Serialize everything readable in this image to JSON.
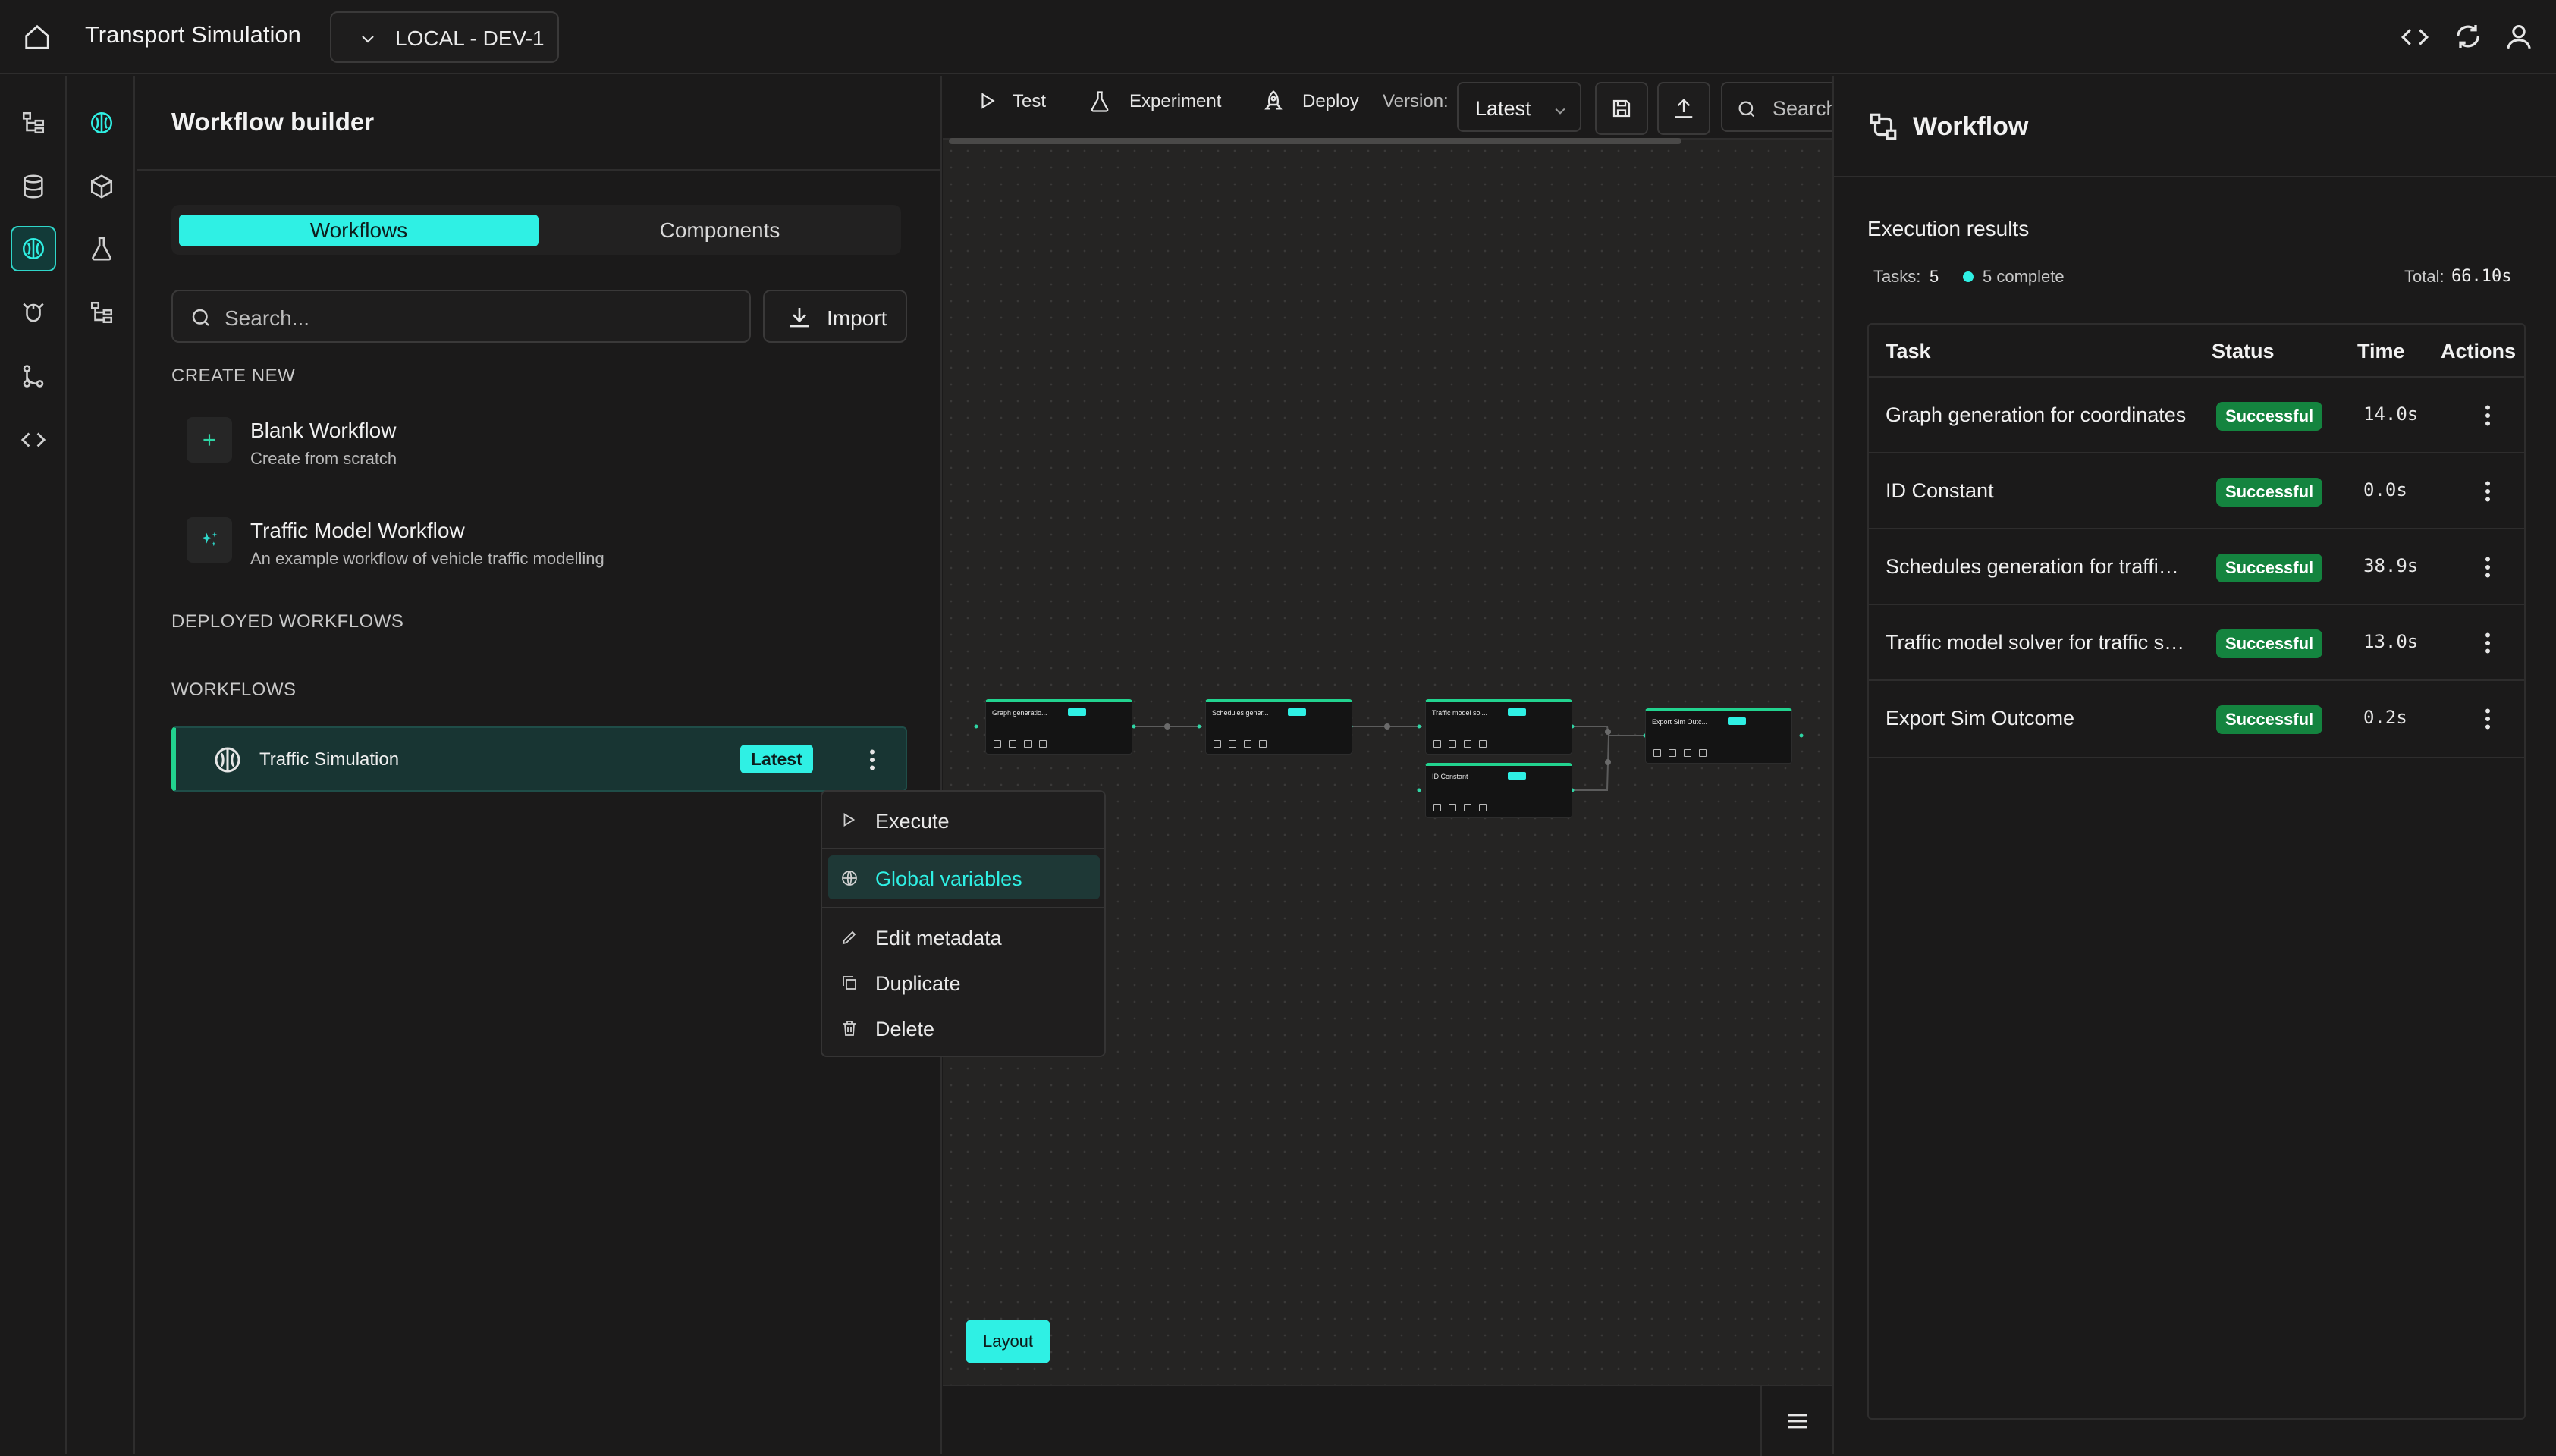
{
  "topbar": {
    "app_title": "Transport Simulation",
    "environment": "LOCAL - DEV-1"
  },
  "left_panel": {
    "title": "Workflow builder",
    "tabs": [
      "Workflows",
      "Components"
    ],
    "active_tab": "Workflows",
    "search_placeholder": "Search...",
    "import_label": "Import",
    "create_new": {
      "heading": "CREATE NEW",
      "items": [
        {
          "title": "Blank Workflow",
          "subtitle": "Create from scratch",
          "icon": "plus-icon"
        },
        {
          "title": "Traffic Model Workflow",
          "subtitle": "An example workflow of vehicle traffic modelling",
          "icon": "sparkles-icon"
        }
      ]
    },
    "deployed_heading": "DEPLOYED WORKFLOWS",
    "workflows_heading": "WORKFLOWS",
    "workflows": [
      {
        "name": "Traffic Simulation",
        "badge": "Latest",
        "icon": "brain-icon"
      }
    ]
  },
  "context_menu": {
    "items": [
      {
        "label": "Execute",
        "icon": "play-icon"
      },
      {
        "label": "Global variables",
        "icon": "globe-icon",
        "highlighted": true
      },
      {
        "label": "Edit metadata",
        "icon": "pencil-icon"
      },
      {
        "label": "Duplicate",
        "icon": "copy-icon"
      },
      {
        "label": "Delete",
        "icon": "trash-icon"
      }
    ]
  },
  "canvas": {
    "toolbar": {
      "test_label": "Test",
      "experiment_label": "Experiment",
      "deploy_label": "Deploy",
      "version_label": "Version:",
      "version_value": "Latest",
      "search_placeholder": "Search"
    },
    "nodes": [
      {
        "title": "Graph generatio..."
      },
      {
        "title": "Schedules gener..."
      },
      {
        "title": "Traffic model sol..."
      },
      {
        "title": "ID Constant"
      },
      {
        "title": "Export Sim Outc..."
      }
    ],
    "layout_label": "Layout"
  },
  "right_panel": {
    "title": "Workflow",
    "section_title": "Execution results",
    "tasks_label": "Tasks:",
    "tasks_count": "5",
    "complete_text": "5 complete",
    "total_label": "Total:",
    "total_value": "66.10s",
    "columns": [
      "Task",
      "Status",
      "Time",
      "Actions"
    ],
    "rows": [
      {
        "task": "Graph generation for coordinates",
        "status": "Successful",
        "time": "14.0s"
      },
      {
        "task": "ID Constant",
        "status": "Successful",
        "time": "0.0s"
      },
      {
        "task": "Schedules generation for traffic simulation",
        "status": "Successful",
        "time": "38.9s"
      },
      {
        "task": "Traffic model solver for traffic simulation",
        "status": "Successful",
        "time": "13.0s"
      },
      {
        "task": "Export Sim Outcome",
        "status": "Successful",
        "time": "0.2s"
      }
    ]
  },
  "colors": {
    "accent": "#2ff0e4",
    "success": "#14843f",
    "background": "#1b1a1a"
  }
}
